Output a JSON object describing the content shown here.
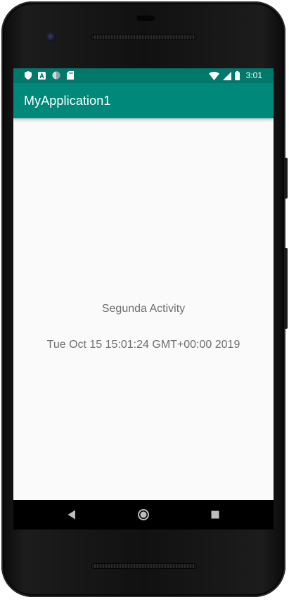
{
  "status_bar": {
    "time": "3:01",
    "left_icons": [
      "shield-icon",
      "a-letter-icon",
      "circle-icon",
      "sd-card-icon"
    ],
    "right_icons": [
      "wifi-icon",
      "cellular-signal-icon",
      "battery-icon"
    ]
  },
  "app_bar": {
    "title": "MyApplication1"
  },
  "content": {
    "title": "Segunda Activity",
    "date": "Tue Oct 15 15:01:24 GMT+00:00 2019"
  },
  "nav_bar": {
    "buttons": [
      "back-icon",
      "home-icon",
      "recents-icon"
    ]
  },
  "colors": {
    "status_bar": "#00796b",
    "app_bar": "#00897b",
    "content_text": "#6e6e6e",
    "background": "#fafafa"
  }
}
